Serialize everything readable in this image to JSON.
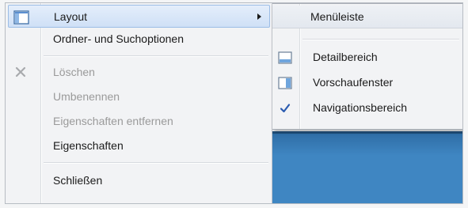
{
  "menu": {
    "items": [
      {
        "label": "Layout",
        "icon": "layout-icon",
        "has_submenu": true,
        "state": "highlighted"
      },
      {
        "label": "Ordner- und Suchoptionen",
        "icon": null,
        "state": "enabled"
      },
      {
        "label": "Löschen",
        "icon": "delete-x-icon",
        "state": "disabled"
      },
      {
        "label": "Umbenennen",
        "icon": null,
        "state": "disabled"
      },
      {
        "label": "Eigenschaften entfernen",
        "icon": null,
        "state": "disabled"
      },
      {
        "label": "Eigenschaften",
        "icon": null,
        "state": "enabled"
      },
      {
        "label": "Schließen",
        "icon": null,
        "state": "enabled"
      }
    ]
  },
  "submenu": {
    "items": [
      {
        "label": "Menüleiste",
        "icon": null,
        "checked": false
      },
      {
        "label": "Detailbereich",
        "icon": "details-pane-icon",
        "checked": false
      },
      {
        "label": "Vorschaufenster",
        "icon": "preview-pane-icon",
        "checked": false
      },
      {
        "label": "Navigationsbereich",
        "icon": "checkmark-icon",
        "checked": true
      }
    ]
  },
  "colors": {
    "highlight": "#cfe0f6",
    "highlight_border": "#9cbde6",
    "disabled_text": "#9a9a9a",
    "desktop_blue": "#3f86c2",
    "check_blue": "#2a5bb0"
  }
}
